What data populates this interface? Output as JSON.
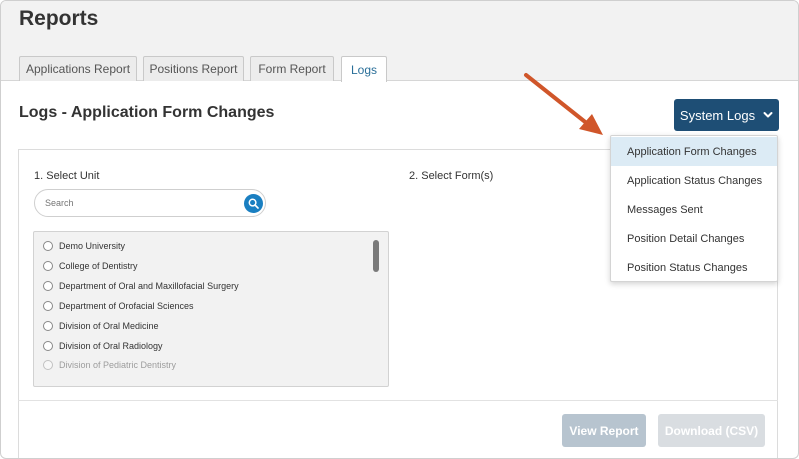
{
  "header": {
    "title": "Reports"
  },
  "tabs": [
    {
      "label": "Applications Report"
    },
    {
      "label": "Positions Report"
    },
    {
      "label": "Form Report"
    },
    {
      "label": "Logs"
    }
  ],
  "section": {
    "title": "Logs - Application Form Changes"
  },
  "system_logs": {
    "label": "System Logs",
    "menu": [
      {
        "label": "Application Form Changes"
      },
      {
        "label": "Application Status Changes"
      },
      {
        "label": "Messages Sent"
      },
      {
        "label": "Position Detail Changes"
      },
      {
        "label": "Position Status Changes"
      }
    ]
  },
  "step1": {
    "label": "1. Select Unit",
    "search_placeholder": "Search",
    "units": [
      {
        "label": "Demo University"
      },
      {
        "label": "College of Dentistry"
      },
      {
        "label": "Department of Oral and Maxillofacial Surgery"
      },
      {
        "label": "Department of Orofacial Sciences"
      },
      {
        "label": "Division of Oral Medicine"
      },
      {
        "label": "Division of Oral Radiology"
      },
      {
        "label": "Division of Pediatric Dentistry"
      }
    ]
  },
  "step2": {
    "label": "2. Select Form(s)"
  },
  "actions": {
    "view_report": "View Report",
    "download_csv": "Download (CSV)"
  },
  "colors": {
    "primary_button": "#1e4e75",
    "active_tab_text": "#2a6f99",
    "search_button": "#1a7fc1",
    "annotation_arrow": "#d0562a",
    "menu_highlight": "#dcebf5"
  }
}
